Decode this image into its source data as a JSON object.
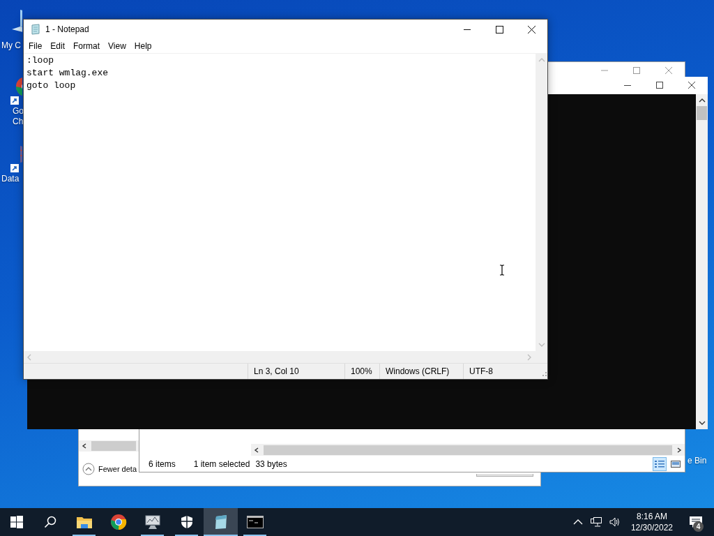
{
  "desktop_icons": [
    {
      "kind": "computer",
      "lines": [
        "My C"
      ]
    },
    {
      "kind": "chrome",
      "lines": [
        "Go",
        "Ch"
      ]
    },
    {
      "kind": "grid",
      "lines": [
        "Data"
      ]
    }
  ],
  "recycle_bin": {
    "label": "e Bin"
  },
  "dialog": {
    "details_toggle": "Fewer deta"
  },
  "explorer": {
    "item_count": "6 items",
    "selection": "1 item selected",
    "size": "33 bytes",
    "views": [
      {
        "kind": "details",
        "selected": true
      },
      {
        "kind": "thumbnails",
        "selected": false
      }
    ]
  },
  "notepad": {
    "title": "1 - Notepad",
    "menu": [
      "File",
      "Edit",
      "Format",
      "View",
      "Help"
    ],
    "lines": [
      ":loop",
      "start wmlag.exe",
      "goto loop"
    ],
    "status": [
      "Ln 3, Col 10",
      "100%",
      "Windows (CRLF)",
      "UTF-8"
    ]
  },
  "taskbar": {
    "apps": [
      {
        "kind": "start",
        "running": false,
        "selected": false
      },
      {
        "kind": "search",
        "running": false,
        "selected": false
      },
      {
        "kind": "folder",
        "running": true,
        "selected": false
      },
      {
        "kind": "chrome",
        "running": false,
        "selected": false
      },
      {
        "kind": "monitor",
        "running": true,
        "selected": false
      },
      {
        "kind": "shield",
        "running": true,
        "selected": false
      },
      {
        "kind": "notepad",
        "running": true,
        "selected": true
      },
      {
        "kind": "console",
        "running": true,
        "selected": false
      }
    ],
    "tray": {
      "time": "8:16 AM",
      "date": "12/30/2022",
      "notifications": "4"
    }
  }
}
